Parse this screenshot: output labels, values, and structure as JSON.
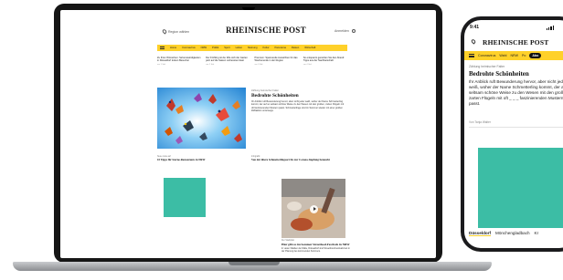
{
  "laptop": {
    "location_label": "Region wählen",
    "logo": "RHEINISCHE POST",
    "login_label": "Anmelden",
    "nav": [
      "Home",
      "Coronavirus",
      "NRW",
      "Politik",
      "Sport",
      "Leben",
      "Meinung",
      "Kultur",
      "Panorama",
      "Reisen",
      "Wirtschaft"
    ],
    "teasers": [
      {
        "title": "Zu Ihren Wünschen: Sehenswürdigkeiten in Düsseldorf locken Besucher",
        "date": "vor 1 Std."
      },
      {
        "title": "Der Frühling ist da: Wie sich der Garten jetzt auf die Saison vorbereiten lässt",
        "date": "vor 2 Std."
      },
      {
        "title": "Premium: Spannende Aussichten für das Wochenende in der Region",
        "date": "vor 3 Std."
      },
      {
        "title": "So entspannt genießen Sie den Abend: Tipps aus der Nachbarschaft",
        "date": "vor 4 Std."
      }
    ],
    "hero": {
      "kicker": "Zählung heimischer Falter",
      "headline": "Bedrohte Schönheiten",
      "body": "Ihr Anblick ruft Bewunderung hervor, aber nicht jeder weiß, woher der Name Schmetterling kommt, der auf so seltsam schöne Weise zu den Wesen mit den großen, zarten Flügeln mit oft faszinierenden Mustern passt. Schmetterlinge sind im Sommer wieder mit einer großen Zählaktion unterwegs."
    },
    "sub_teasers": [
      {
        "kicker": "Neue Liste auf",
        "title": "10 Tipps für Sterne-Restaurants in NRW"
      },
      {
        "kicker": "Infografik",
        "title": "Von der ältere Schmetterlingsart bis zur Corona-Impfung bezeucht"
      }
    ],
    "video": {
      "kicker": "Der Stadtplan",
      "title": "Hier gibt es im Sommer Streetfood-Festivals in NRW",
      "body": "In vielen Städten der Ralle, Düsseldorf sind Streetfood-Festivals fest in der Planung des kommenden Sommers."
    }
  },
  "phone": {
    "time": "9:41",
    "logo": "RHEINISCHE POST",
    "nav": [
      "Coronavirus",
      "Wahl",
      "NRW",
      "Po"
    ],
    "nav_pill": "Abo",
    "kicker": "Zählung heimischer Falter",
    "headline": "Bedrohte Schönheiten",
    "body": "Ihr Anblick ruft Bewunderung hervor, aber nicht jeder weiß, woher der Name Schmetterling kommt, der auf so seltsam schöne Weise zu den Wesen mit den großen, zarten Flügeln mit oft _ _ _ faszinierenden Mustern passt.",
    "author": "Von Tanja Walter",
    "cities": [
      "Düsseldorf",
      "Mönchengladbach",
      "Kr"
    ]
  },
  "colors": {
    "accent": "#ffd12a",
    "ad_teal": "#3cbda5",
    "device_frame": "#161616"
  }
}
